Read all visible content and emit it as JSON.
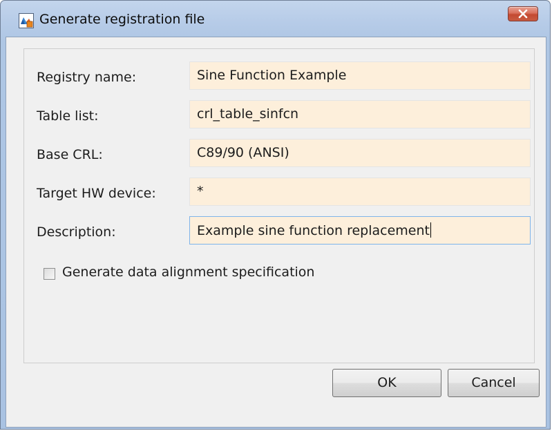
{
  "window": {
    "title": "Generate registration file"
  },
  "form": {
    "registry_name": {
      "label": "Registry name:",
      "value": "Sine Function Example"
    },
    "table_list": {
      "label": "Table list:",
      "value": "crl_table_sinfcn"
    },
    "base_crl": {
      "label": "Base CRL:",
      "value": "C89/90 (ANSI)"
    },
    "target_hw_device": {
      "label": "Target HW device:",
      "value": "*"
    },
    "description": {
      "label": "Description:",
      "value": "Example sine function replacement"
    },
    "data_alignment": {
      "label": "Generate data alignment specification",
      "checked": false
    }
  },
  "buttons": {
    "ok_label": "OK",
    "cancel_label": "Cancel"
  },
  "colors": {
    "field_background": "#fdefdb",
    "dialog_background": "#f0f0f0",
    "close_button": "#c44a32"
  },
  "icons": {
    "app": "matlab-dialog-icon",
    "close": "close-icon",
    "checkbox": "checkbox-unchecked-icon"
  }
}
